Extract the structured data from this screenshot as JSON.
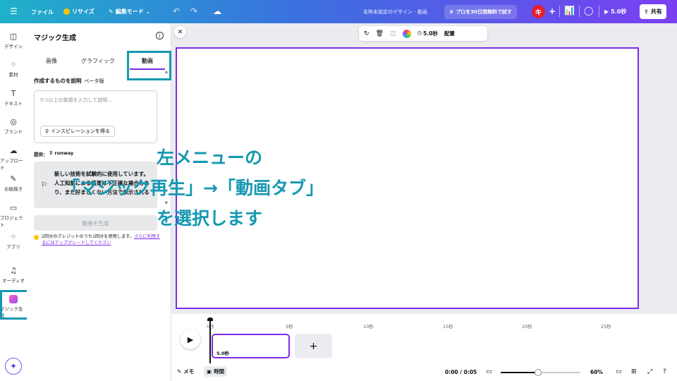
{
  "topbar": {
    "menu_icon": "☰",
    "file": "ファイル",
    "resize": "リサイズ",
    "edit_mode": "編集モード",
    "doc_title": "名称未設定のデザイン - 動画",
    "pro_trial": "プロを30日間無料で試す",
    "avatar_initial": "キ",
    "play_duration": "5.0秒",
    "share": "共有"
  },
  "rail": {
    "items": [
      {
        "label": "デザイン",
        "icon": "layout-icon"
      },
      {
        "label": "素材",
        "icon": "elements-icon"
      },
      {
        "label": "テキスト",
        "icon": "text-icon"
      },
      {
        "label": "ブランド",
        "icon": "brand-icon"
      },
      {
        "label": "アップロード",
        "icon": "upload-icon"
      },
      {
        "label": "お絵描き",
        "icon": "draw-icon"
      },
      {
        "label": "プロジェクト",
        "icon": "folder-icon"
      },
      {
        "label": "アプリ",
        "icon": "apps-icon"
      },
      {
        "label": "オーディオ",
        "icon": "audio-icon"
      },
      {
        "label": "マジック生成",
        "icon": "magic-icon"
      }
    ]
  },
  "panel": {
    "title": "マジック生成",
    "tabs": {
      "image": "画像",
      "graphic": "グラフィック",
      "video": "動画"
    },
    "describe_label": "作成するものを説明",
    "beta": "ベータ版",
    "prompt_placeholder": "5つ以上の単語を入力して説明...",
    "inspiration": "インスピレーションを得る",
    "provider_label": "提供：",
    "provider_name": "runway",
    "notice_text": "新しい技術を試験的に使用しています。人工知能による結果は不正確な場合もあり、また好ましくない方法で表示されることもあります。",
    "generate": "動画を生成",
    "credit_text": "2回分のクレジットのうち1回分を使用します。",
    "credit_link": "さらに利用するにはアップグレードしてください"
  },
  "toolbar": {
    "duration": "5.0秒",
    "arrange": "配置"
  },
  "overlay": {
    "line1": "左メニューの",
    "line2": "「マジック再生」→「動画タブ」",
    "line3": "を選択します"
  },
  "timeline": {
    "ticks": [
      "0秒",
      "5秒",
      "10秒",
      "15秒",
      "20秒",
      "25秒"
    ],
    "clip_duration": "5.0秒",
    "add": "+",
    "notes": "メモ",
    "time": "時間",
    "timecode": "0:00 / 0:05",
    "zoom": "60%",
    "zoom_fraction": 0.47,
    "help": "?"
  },
  "colors": {
    "accent": "#7d2ae8",
    "annotation": "#1698b1"
  }
}
